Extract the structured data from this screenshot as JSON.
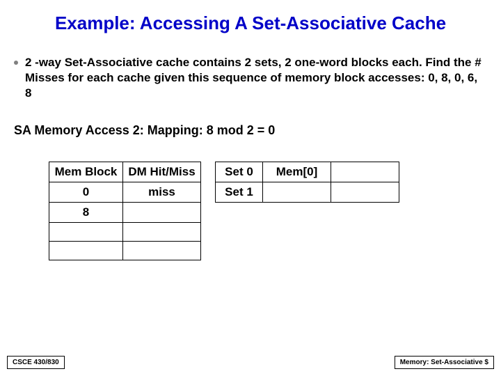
{
  "title": "Example: Accessing A Set-Associative Cache",
  "bullet": "2 -way Set-Associative cache contains 2 sets, 2 one-word blocks each. Find the # Misses for each cache given this sequence of memory block accesses: 0, 8, 0, 6, 8",
  "subheading": "SA Memory Access 2:  Mapping: 8 mod 2 = 0",
  "table1": {
    "headers": [
      "Mem Block",
      "DM Hit/Miss"
    ],
    "rows": [
      [
        "0",
        "miss"
      ],
      [
        "8",
        ""
      ],
      [
        "",
        ""
      ],
      [
        "",
        ""
      ]
    ]
  },
  "table2": {
    "rows": [
      [
        "Set 0",
        "Mem[0]",
        ""
      ],
      [
        "Set 1",
        "",
        ""
      ]
    ]
  },
  "footer": {
    "left": "CSCE 430/830",
    "right": "Memory: Set-Associative $"
  }
}
